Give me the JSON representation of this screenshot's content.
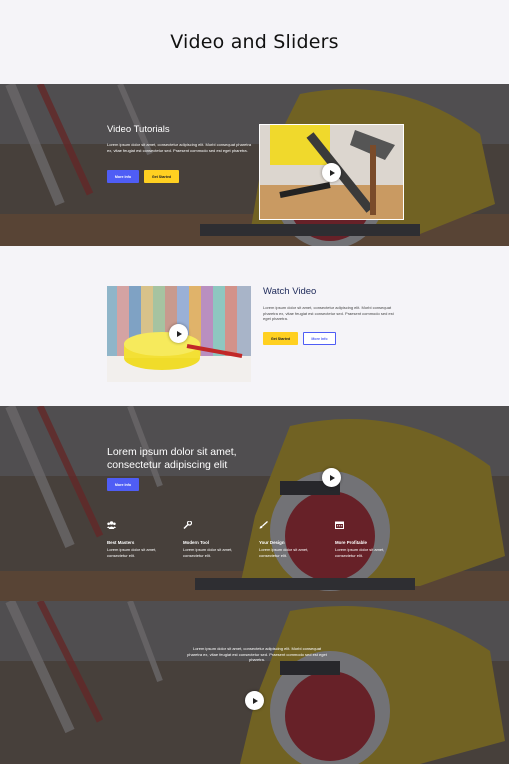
{
  "page_title": "Video and Sliders",
  "tutorials": {
    "heading": "Video Tutorials",
    "body": "Lorem ipsum dolor sit amet, consectetur adipiscing elit. Morbi consequat pharetra ex, vitae feugiat est consectetur sed. Praesent commodo sed est eget pharetra.",
    "more_info": "More Info",
    "get_started": "Get Started"
  },
  "watch": {
    "heading": "Watch Video",
    "body": "Lorem ipsum dolor sit amet, consectetur adipiscing elit. Morbi consequat pharetra ex, vitae feugiat est consectetur sed. Praesent commodo sed est eget pharetra.",
    "get_started": "Get Started",
    "more_info": "More Info"
  },
  "hero": {
    "heading_line1": "Lorem ipsum dolor sit amet,",
    "heading_line2": "consectetur adipiscing elit",
    "more_info": "More Info",
    "features": [
      {
        "icon": "team-icon",
        "title": "Best Masters",
        "body": "Lorem ipsum dolor sit amet, consectetur elit."
      },
      {
        "icon": "wrench-icon",
        "title": "Modern Tool",
        "body": "Lorem ipsum dolor sit amet, consectetur elit."
      },
      {
        "icon": "brush-icon",
        "title": "Your Design",
        "body": "Lorem ipsum dolor sit amet, consectetur elit."
      },
      {
        "icon": "calendar-icon",
        "title": "More Profitable",
        "body": "Lorem ipsum dolor sit amet, consectetur elit."
      }
    ]
  },
  "slider": {
    "body": "Lorem ipsum dolor sit amet, consectetur adipiscing elit. Morbi consequat pharetra ex, vitae feugiat est consectetur sed. Praesent commodo sed est eget pharetra."
  },
  "colors": {
    "accent_blue": "#4f5df5",
    "accent_yellow": "#ffd021",
    "heading_navy": "#1e2a5a"
  }
}
